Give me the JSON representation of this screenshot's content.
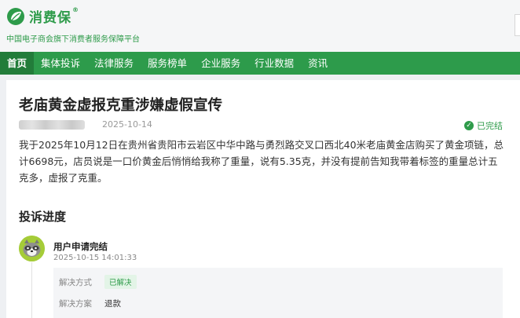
{
  "brand": {
    "name": "消费保",
    "reg_mark": "®",
    "tagline": "中国电子商会旗下消费者服务保障平台",
    "color": "#2e9b4a"
  },
  "nav": {
    "items": [
      {
        "label": "首页",
        "active": true
      },
      {
        "label": "集体投诉"
      },
      {
        "label": "法律服务"
      },
      {
        "label": "服务榜单"
      },
      {
        "label": "企业服务"
      },
      {
        "label": "行业数据"
      },
      {
        "label": "资讯"
      }
    ],
    "color": "#2d9b4b"
  },
  "complaint": {
    "title": "老庙黄金虚报克重涉嫌虚假宣传",
    "date": "2025-10-14",
    "status": "已完结",
    "description": "我于2025年10月12日在贵州省贵阳市云岩区中华中路与勇烈路交叉口西北40米老庙黄金店购买了黄金项链，总计6698元，店员说是一口价黄金后悄悄给我称了重量，说有5.35克，并没有提前告知我带着标签的重量总计五克多，虚报了克重。"
  },
  "progress": {
    "section_title": "投诉进度",
    "steps": [
      {
        "title": "用户申请完结",
        "time": "2025-10-15 14:01:33",
        "resolution_label": "解决方式",
        "resolution_value": "已解决",
        "plan_label": "解决方案",
        "plan_value": "退款"
      }
    ]
  }
}
